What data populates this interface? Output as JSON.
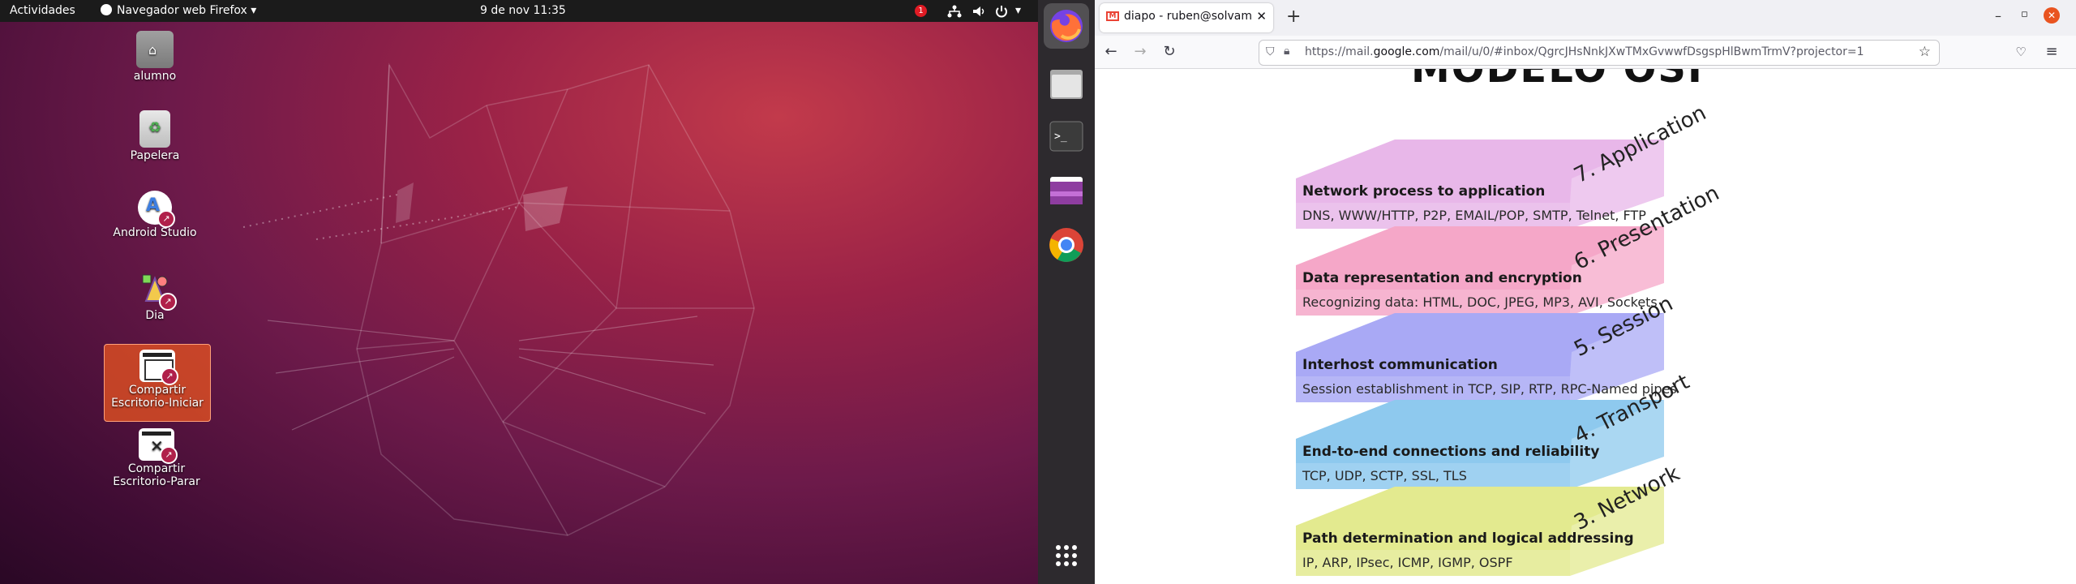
{
  "left_topbar": {
    "activities": "Actividades",
    "app_menu": "Navegador web Firefox",
    "clock": "9 de nov  11:35",
    "notification_count": "1"
  },
  "desktop_icons": [
    {
      "label": "alumno",
      "icon": "home-folder-icon"
    },
    {
      "label": "Papelera",
      "icon": "trash-icon"
    },
    {
      "label": "Android Studio",
      "icon": "android-studio-icon"
    },
    {
      "label": "Dia",
      "icon": "dia-icon"
    },
    {
      "label": "Compartir Escritorio-Iniciar",
      "icon": "share-desktop-start-icon"
    },
    {
      "label": "Compartir Escritorio-Parar",
      "icon": "share-desktop-stop-icon"
    }
  ],
  "dock": [
    {
      "name": "Firefox",
      "icon": "firefox-icon"
    },
    {
      "name": "Files",
      "icon": "files-icon"
    },
    {
      "name": "Terminal",
      "icon": "terminal-icon"
    },
    {
      "name": "Window",
      "icon": "window-icon"
    },
    {
      "name": "Chrome",
      "icon": "chrome-icon"
    },
    {
      "name": "Show Applications",
      "icon": "app-grid-icon"
    }
  ],
  "browser": {
    "tab_title": "diapo - ruben@solvam.es",
    "url_host": "https://mail.",
    "url_domain": "google.com",
    "url_path": "/mail/u/0/#inbox/QgrcJHsNnkJXwTMxGvwwfDsgspHlBwmTrmV?projector=1"
  },
  "slide": {
    "title_fragment": "MODELO OSI",
    "layers": [
      {
        "name": "7. Application",
        "label": "Network process to application",
        "protocols": "DNS, WWW/HTTP, P2P, EMAIL/POP, SMTP, Telnet, FTP",
        "color": "#e8b7e9"
      },
      {
        "name": "6. Presentation",
        "label": "Data representation and encryption",
        "protocols": "Recognizing data: HTML, DOC, JPEG, MP3, AVI, Sockets",
        "color": "#f5a7c8"
      },
      {
        "name": "5. Session",
        "label": "Interhost communication",
        "protocols": "Session establishment in TCP, SIP, RTP, RPC-Named pipes",
        "color": "#a9a9f5"
      },
      {
        "name": "4. Transport",
        "label": "End-to-end connections and reliability",
        "protocols": "TCP, UDP, SCTP, SSL, TLS",
        "color": "#8ec9ee"
      },
      {
        "name": "3. Network",
        "label": "Path determination and logical addressing",
        "protocols": "IP, ARP, IPsec, ICMP, IGMP, OSPF",
        "color": "#e3ea8f"
      }
    ]
  }
}
